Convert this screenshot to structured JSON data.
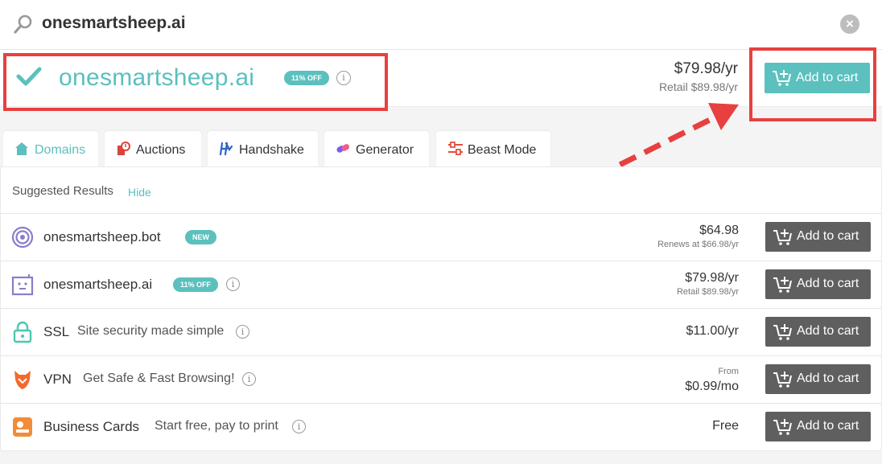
{
  "search": {
    "query": "onesmartsheep.ai"
  },
  "main_result": {
    "domain": "onesmartsheep.ai",
    "badge": "11% OFF",
    "price": "$79.98/yr",
    "retail": "Retail $89.98/yr",
    "cart_label": "Add to cart"
  },
  "tabs": [
    {
      "label": "Domains",
      "icon": "house-icon",
      "active": true
    },
    {
      "label": "Auctions",
      "icon": "gavel-icon"
    },
    {
      "label": "Handshake",
      "icon": "handshake-icon"
    },
    {
      "label": "Generator",
      "icon": "generator-icon"
    },
    {
      "label": "Beast Mode",
      "icon": "sliders-icon"
    }
  ],
  "suggested": {
    "title": "Suggested Results",
    "hide": "Hide"
  },
  "rows": [
    {
      "name": "onesmartsheep.bot",
      "badge": "NEW",
      "price": "$64.98",
      "note": "Renews at $66.98/yr",
      "cart_label": "Add to cart",
      "icon": "target-icon"
    },
    {
      "name": "onesmartsheep.ai",
      "badge": "11% OFF",
      "price": "$79.98/yr",
      "note": "Retail $89.98/yr",
      "cart_label": "Add to cart",
      "icon": "robot-icon"
    },
    {
      "name": "SSL",
      "sub": "Site security made simple",
      "price": "$11.00/yr",
      "cart_label": "Add to cart",
      "icon": "lock-icon"
    },
    {
      "name": "VPN",
      "sub": "Get Safe & Fast Browsing!",
      "from": "From",
      "price": "$0.99/mo",
      "cart_label": "Add to cart",
      "icon": "fox-shield-icon"
    },
    {
      "name": "Business Cards",
      "sub": "Start free, pay to print",
      "price": "Free",
      "cart_label": "Add to cart",
      "icon": "card-icon"
    }
  ],
  "colors": {
    "accent": "#5bc0be",
    "highlight": "#e8403f",
    "button_dark": "#5f5f5f"
  }
}
